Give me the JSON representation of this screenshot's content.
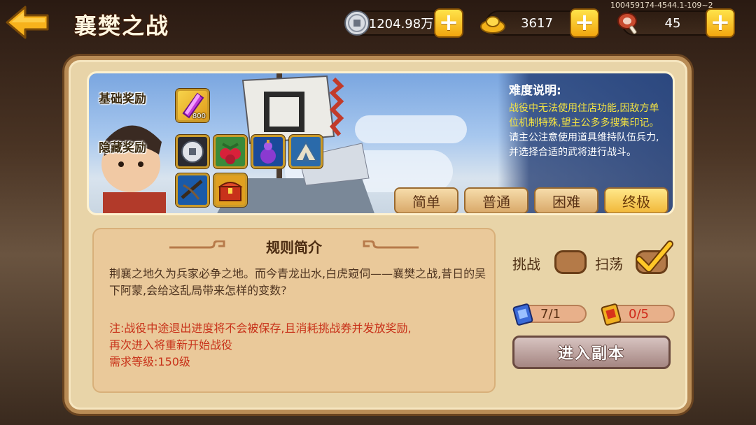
{
  "header": {
    "title": "襄樊之战",
    "server_id": "100459174-4544.1-109~2"
  },
  "resources": [
    {
      "name": "silver",
      "icon": "silver-coin-icon",
      "value": "1204.98万"
    },
    {
      "name": "gold",
      "icon": "gold-ingot-icon",
      "value": "3617"
    },
    {
      "name": "stamina",
      "icon": "meat-icon",
      "value": "45"
    }
  ],
  "plus_label": "+",
  "banner": {
    "basic_reward_label": "基础奖励",
    "hidden_reward_label": "隐藏奖励",
    "basic_item_count": "800",
    "difficulty_title": "难度说明:",
    "difficulty_text_yellow": "战役中无法使用住店功能,因敌方单位机制特殊,望主公多多搜集印记。",
    "difficulty_text_white": "请主公注意使用道具维持队伍兵力,并选择合适的武将进行战斗。",
    "tabs": [
      {
        "label": "简单",
        "active": false
      },
      {
        "label": "普通",
        "active": false
      },
      {
        "label": "困难",
        "active": false
      },
      {
        "label": "终极",
        "active": true
      }
    ]
  },
  "rules": {
    "title": "规则简介",
    "text": "荆襄之地久为兵家必争之地。而今青龙出水,白虎窥伺——襄樊之战,昔日的吴下阿蒙,会给这乱局带来怎样的变数?",
    "note_line1": "注:战役中途退出进度将不会被保存,且消耗挑战券并发放奖励,",
    "note_line2": "再次进入将重新开始战役",
    "note_line3": "需求等级:150级"
  },
  "controls": {
    "challenge_label": "挑战",
    "challenge_checked": false,
    "sweep_label": "扫荡",
    "sweep_checked": true,
    "ticket_count": "7/1",
    "token_count": "0/5",
    "enter_label": "进入副本"
  }
}
